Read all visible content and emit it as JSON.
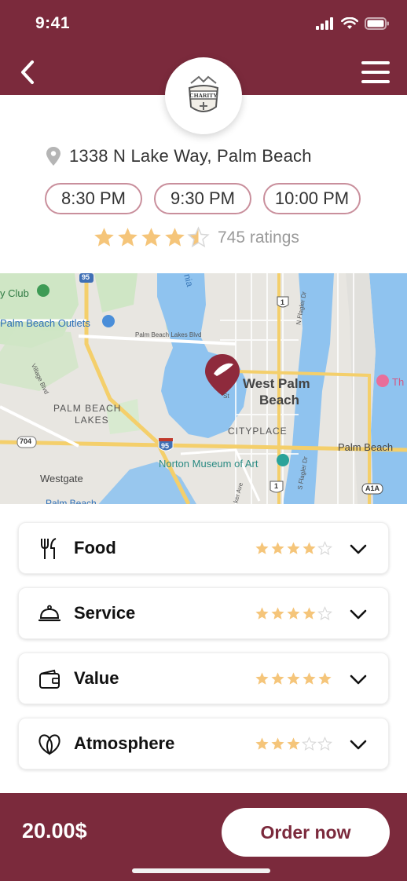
{
  "status_bar": {
    "time": "9:41"
  },
  "header": {
    "logo_text": "CHARITY"
  },
  "restaurant": {
    "address": "1338 N Lake Way, Palm Beach",
    "times": [
      "8:30 PM",
      "9:30 PM",
      "10:00 PM"
    ],
    "rating": 4.5,
    "ratings_label": "745 ratings"
  },
  "map": {
    "labels": {
      "club": "y Club",
      "outlets": "Palm Beach Outlets",
      "lakes_blvd": "Palm Beach Lakes Blvd",
      "west_palm_1": "West Palm",
      "west_palm_2": "Beach",
      "pb_lakes_1": "PALM BEACH",
      "pb_lakes_2": "LAKES",
      "cityplace": "CITYPLACE",
      "norton": "Norton Museum of Art",
      "palm_beach": "Palm Beach",
      "westgate": "Westgate",
      "village_blvd": "Village Blvd",
      "n_flagler": "N Flagler Dr",
      "s_flagler": "S Flagler Dr",
      "tamarind": "Tamarind",
      "rt95_top": "95",
      "rt95": "95",
      "rt704": "704",
      "rt1_top": "1",
      "rt1_bottom": "1",
      "a1a": "A1A",
      "th": "Th",
      "palm_beach_bottom": "Palm Beach",
      "nia": "nia",
      "st": "St",
      "baker_ave": "ker Ave"
    }
  },
  "categories": [
    {
      "label": "Food",
      "icon": "fork-knife-icon",
      "rating": 4
    },
    {
      "label": "Service",
      "icon": "cloche-icon",
      "rating": 4
    },
    {
      "label": "Value",
      "icon": "wallet-icon",
      "rating": 5
    },
    {
      "label": "Atmosphere",
      "icon": "heart-leaves-icon",
      "rating": 3
    }
  ],
  "footer": {
    "price": "20.00$",
    "order_label": "Order now"
  },
  "colors": {
    "brand": "#7b2a3c",
    "star": "#f5c57a",
    "star_empty": "#d7d7d7"
  }
}
